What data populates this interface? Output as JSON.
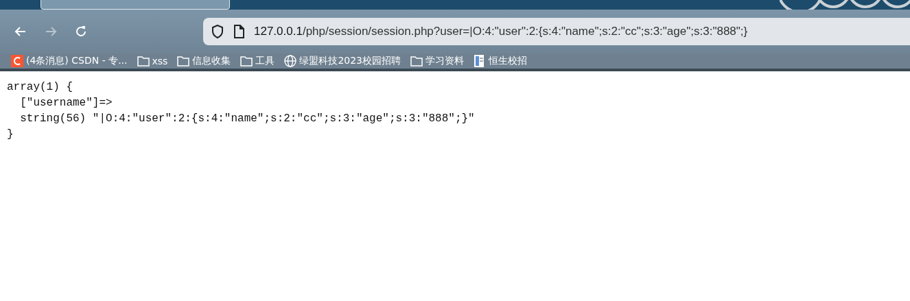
{
  "browser": {
    "address": {
      "host": "127.0.0.1",
      "path": "/php/session/session.php?user=|O:4:\"user\":2:{s:4:\"name\";s:2:\"cc\";s:3:\"age\";s:3:\"888\";}"
    },
    "bookmarks": [
      {
        "kind": "site",
        "label": "(4条消息) CSDN - 专..."
      },
      {
        "kind": "folder",
        "label": "xss"
      },
      {
        "kind": "folder",
        "label": "信息收集"
      },
      {
        "kind": "folder",
        "label": "工具"
      },
      {
        "kind": "globe",
        "label": "绿盟科技2023校园招聘"
      },
      {
        "kind": "folder",
        "label": "学习资料"
      },
      {
        "kind": "doc",
        "label": "恒生校招"
      }
    ]
  },
  "page": {
    "lines": [
      "array(1) {",
      "  [\"username\"]=>",
      "  string(56) \"|O:4:\"user\":2:{s:4:\"name\";s:2:\"cc\";s:3:\"age\";s:3:\"888\";}\"",
      "}"
    ]
  }
}
